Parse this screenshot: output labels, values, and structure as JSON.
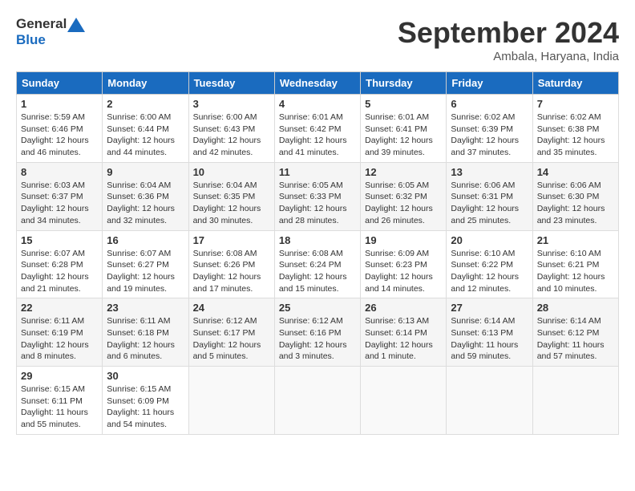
{
  "header": {
    "logo": {
      "general": "General",
      "blue": "Blue"
    },
    "title": "September 2024",
    "location": "Ambala, Haryana, India"
  },
  "calendar": {
    "columns": [
      "Sunday",
      "Monday",
      "Tuesday",
      "Wednesday",
      "Thursday",
      "Friday",
      "Saturday"
    ],
    "weeks": [
      [
        null,
        null,
        null,
        null,
        null,
        null,
        null
      ]
    ],
    "days": [
      {
        "date": 1,
        "col": 0,
        "sunrise": "5:59 AM",
        "sunset": "6:46 PM",
        "daylight": "12 hours and 46 minutes."
      },
      {
        "date": 2,
        "col": 1,
        "sunrise": "6:00 AM",
        "sunset": "6:44 PM",
        "daylight": "12 hours and 44 minutes."
      },
      {
        "date": 3,
        "col": 2,
        "sunrise": "6:00 AM",
        "sunset": "6:43 PM",
        "daylight": "12 hours and 42 minutes."
      },
      {
        "date": 4,
        "col": 3,
        "sunrise": "6:01 AM",
        "sunset": "6:42 PM",
        "daylight": "12 hours and 41 minutes."
      },
      {
        "date": 5,
        "col": 4,
        "sunrise": "6:01 AM",
        "sunset": "6:41 PM",
        "daylight": "12 hours and 39 minutes."
      },
      {
        "date": 6,
        "col": 5,
        "sunrise": "6:02 AM",
        "sunset": "6:39 PM",
        "daylight": "12 hours and 37 minutes."
      },
      {
        "date": 7,
        "col": 6,
        "sunrise": "6:02 AM",
        "sunset": "6:38 PM",
        "daylight": "12 hours and 35 minutes."
      },
      {
        "date": 8,
        "col": 0,
        "sunrise": "6:03 AM",
        "sunset": "6:37 PM",
        "daylight": "12 hours and 34 minutes."
      },
      {
        "date": 9,
        "col": 1,
        "sunrise": "6:04 AM",
        "sunset": "6:36 PM",
        "daylight": "12 hours and 32 minutes."
      },
      {
        "date": 10,
        "col": 2,
        "sunrise": "6:04 AM",
        "sunset": "6:35 PM",
        "daylight": "12 hours and 30 minutes."
      },
      {
        "date": 11,
        "col": 3,
        "sunrise": "6:05 AM",
        "sunset": "6:33 PM",
        "daylight": "12 hours and 28 minutes."
      },
      {
        "date": 12,
        "col": 4,
        "sunrise": "6:05 AM",
        "sunset": "6:32 PM",
        "daylight": "12 hours and 26 minutes."
      },
      {
        "date": 13,
        "col": 5,
        "sunrise": "6:06 AM",
        "sunset": "6:31 PM",
        "daylight": "12 hours and 25 minutes."
      },
      {
        "date": 14,
        "col": 6,
        "sunrise": "6:06 AM",
        "sunset": "6:30 PM",
        "daylight": "12 hours and 23 minutes."
      },
      {
        "date": 15,
        "col": 0,
        "sunrise": "6:07 AM",
        "sunset": "6:28 PM",
        "daylight": "12 hours and 21 minutes."
      },
      {
        "date": 16,
        "col": 1,
        "sunrise": "6:07 AM",
        "sunset": "6:27 PM",
        "daylight": "12 hours and 19 minutes."
      },
      {
        "date": 17,
        "col": 2,
        "sunrise": "6:08 AM",
        "sunset": "6:26 PM",
        "daylight": "12 hours and 17 minutes."
      },
      {
        "date": 18,
        "col": 3,
        "sunrise": "6:08 AM",
        "sunset": "6:24 PM",
        "daylight": "12 hours and 15 minutes."
      },
      {
        "date": 19,
        "col": 4,
        "sunrise": "6:09 AM",
        "sunset": "6:23 PM",
        "daylight": "12 hours and 14 minutes."
      },
      {
        "date": 20,
        "col": 5,
        "sunrise": "6:10 AM",
        "sunset": "6:22 PM",
        "daylight": "12 hours and 12 minutes."
      },
      {
        "date": 21,
        "col": 6,
        "sunrise": "6:10 AM",
        "sunset": "6:21 PM",
        "daylight": "12 hours and 10 minutes."
      },
      {
        "date": 22,
        "col": 0,
        "sunrise": "6:11 AM",
        "sunset": "6:19 PM",
        "daylight": "12 hours and 8 minutes."
      },
      {
        "date": 23,
        "col": 1,
        "sunrise": "6:11 AM",
        "sunset": "6:18 PM",
        "daylight": "12 hours and 6 minutes."
      },
      {
        "date": 24,
        "col": 2,
        "sunrise": "6:12 AM",
        "sunset": "6:17 PM",
        "daylight": "12 hours and 5 minutes."
      },
      {
        "date": 25,
        "col": 3,
        "sunrise": "6:12 AM",
        "sunset": "6:16 PM",
        "daylight": "12 hours and 3 minutes."
      },
      {
        "date": 26,
        "col": 4,
        "sunrise": "6:13 AM",
        "sunset": "6:14 PM",
        "daylight": "12 hours and 1 minute."
      },
      {
        "date": 27,
        "col": 5,
        "sunrise": "6:14 AM",
        "sunset": "6:13 PM",
        "daylight": "11 hours and 59 minutes."
      },
      {
        "date": 28,
        "col": 6,
        "sunrise": "6:14 AM",
        "sunset": "6:12 PM",
        "daylight": "11 hours and 57 minutes."
      },
      {
        "date": 29,
        "col": 0,
        "sunrise": "6:15 AM",
        "sunset": "6:11 PM",
        "daylight": "11 hours and 55 minutes."
      },
      {
        "date": 30,
        "col": 1,
        "sunrise": "6:15 AM",
        "sunset": "6:09 PM",
        "daylight": "11 hours and 54 minutes."
      }
    ]
  }
}
